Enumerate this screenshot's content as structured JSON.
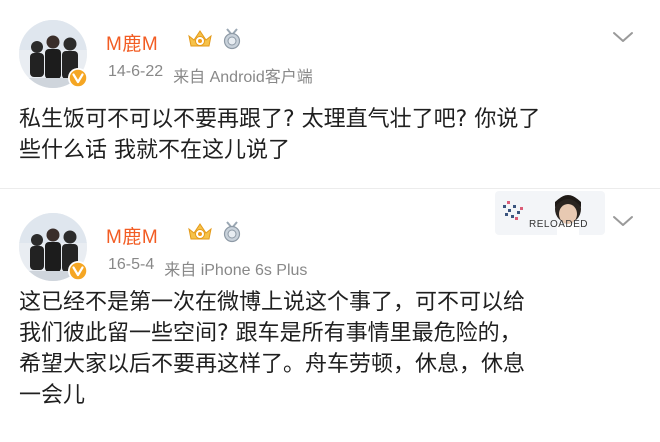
{
  "posts": [
    {
      "username": "M鹿M",
      "date": "14-6-22",
      "source": "来自 Android客户端",
      "content": "私生饭可不可以不要再跟了? 太理直气壮了吧? 你说了\n些什么话 我就不在这儿说了",
      "icons": [
        "avatar-group-photo",
        "verified-v-icon",
        "crown-level-icon",
        "medal-icon",
        "chevron-down-icon"
      ]
    },
    {
      "username": "M鹿M",
      "date": "16-5-4",
      "source": "来自 iPhone 6s Plus",
      "content": "这已经不是第一次在微博上说这个事了，可不可以给\n我们彼此留一些空间? 跟车是所有事情里最危险的，\n希望大家以后不要再这样了。舟车劳顿，休息，休息\n一会儿",
      "card_label": "RELOADED",
      "icons": [
        "avatar-group-photo",
        "verified-v-icon",
        "crown-level-icon",
        "medal-icon",
        "chevron-down-icon"
      ]
    }
  ],
  "colors": {
    "username": "#f25c23",
    "meta": "#888888",
    "text": "#1f1f1f",
    "verified": "#f5a623"
  }
}
